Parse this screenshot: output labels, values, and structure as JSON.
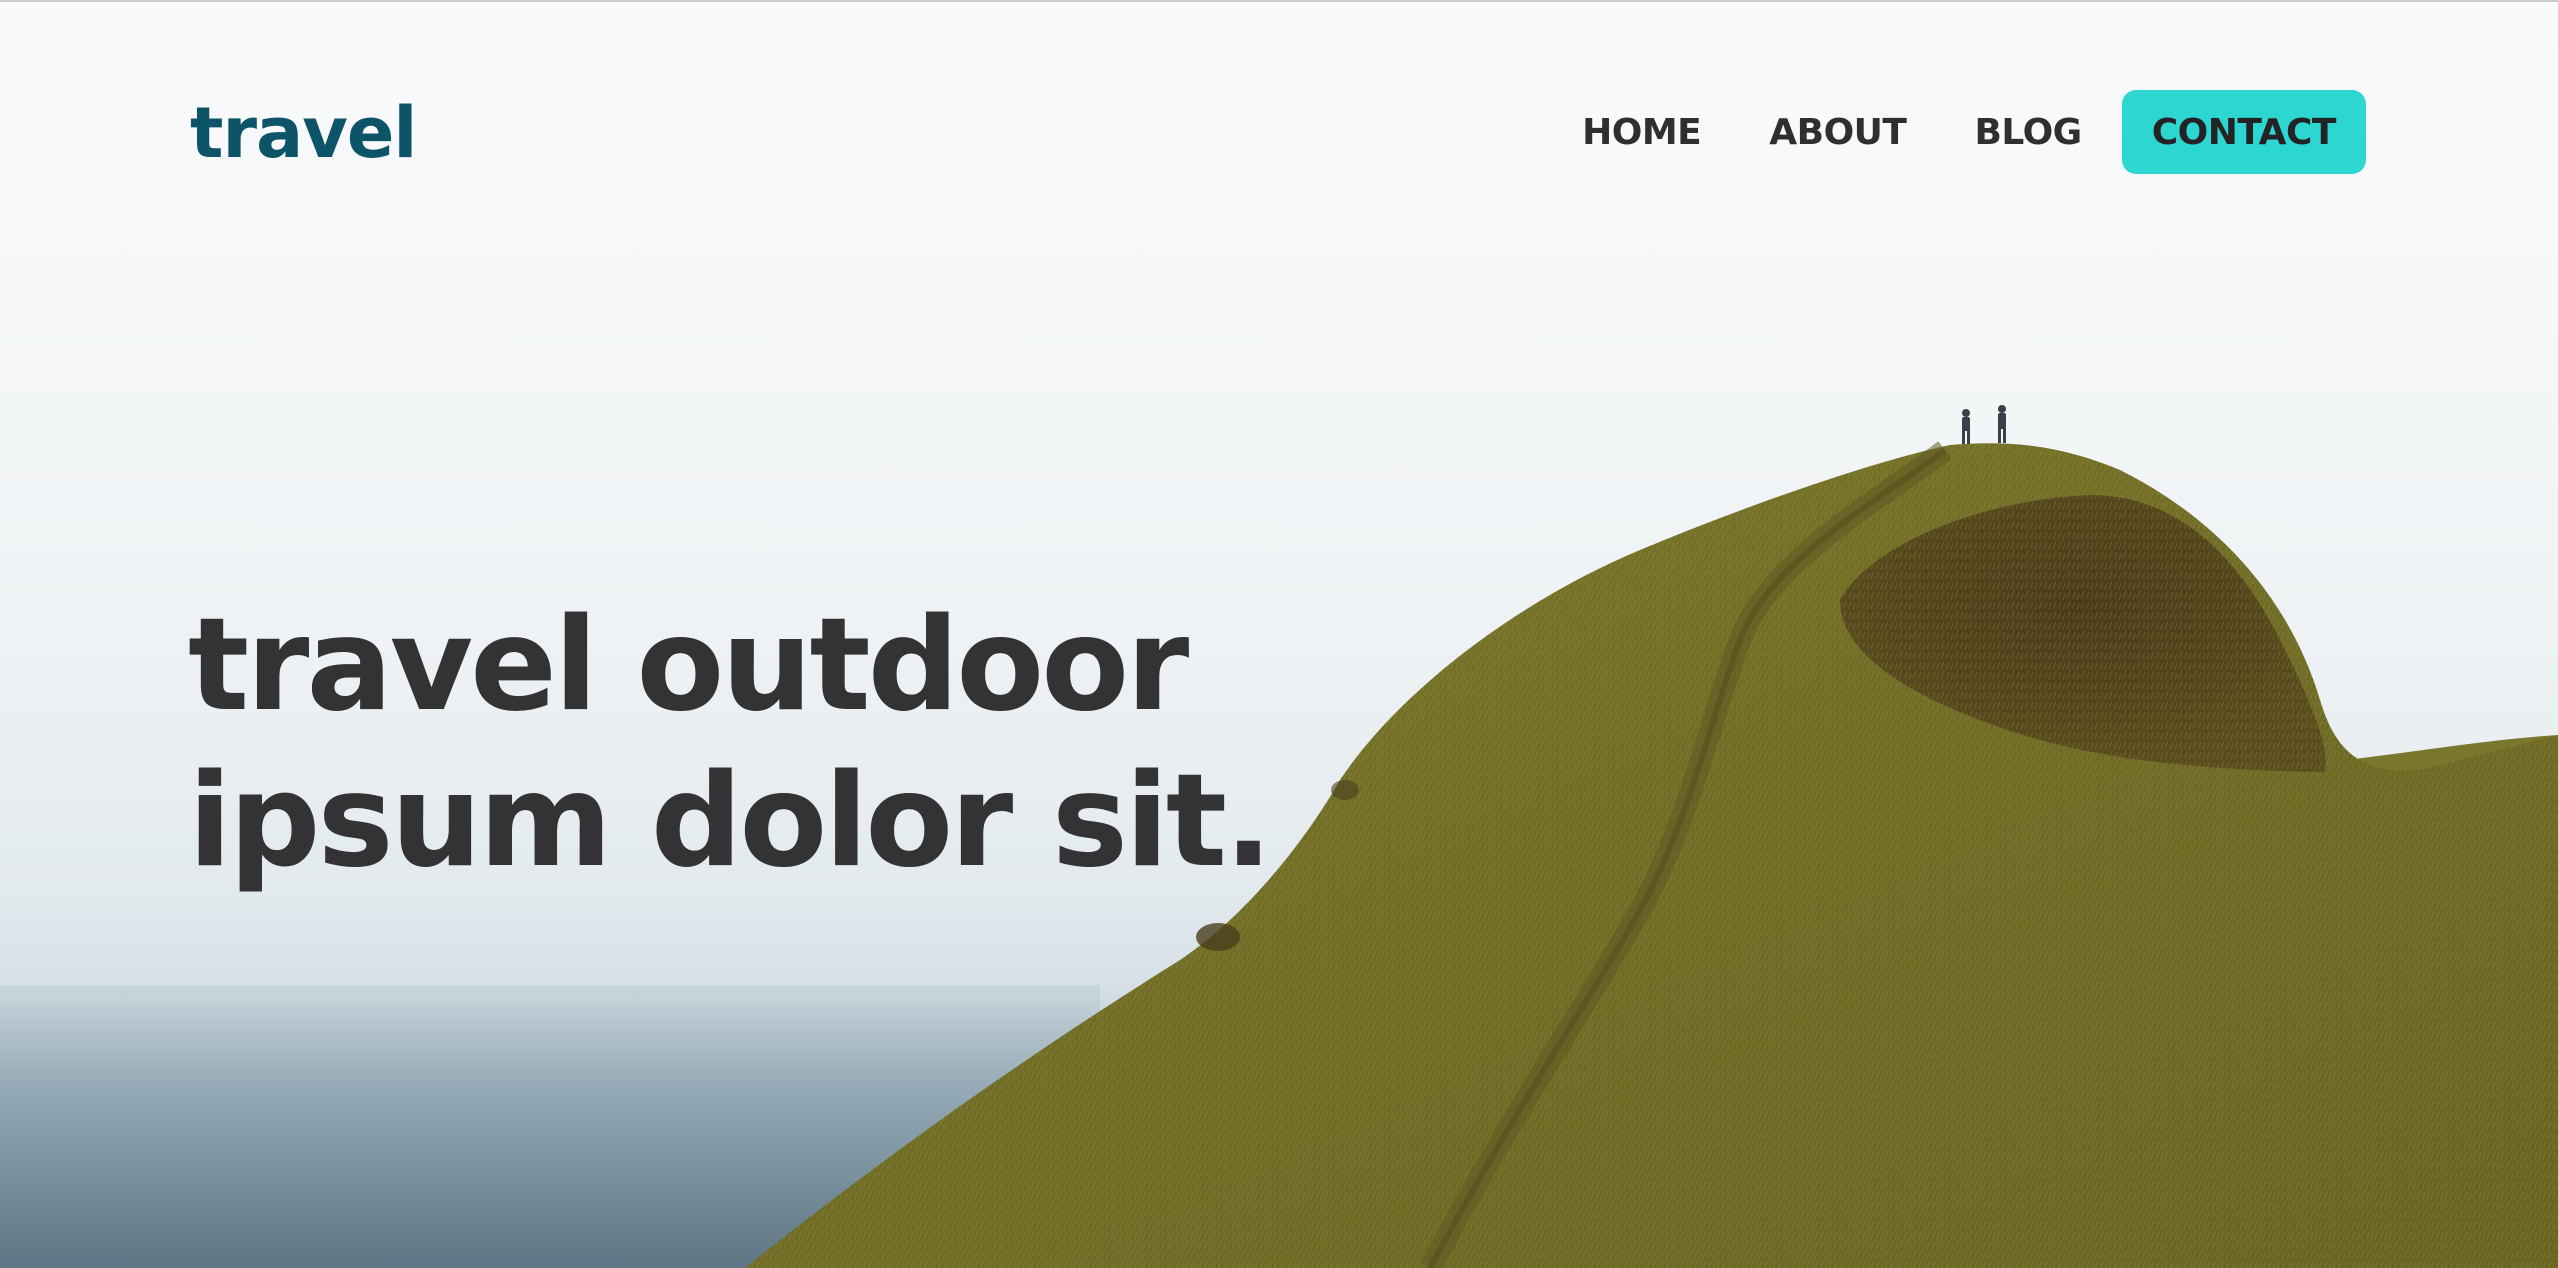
{
  "brand": {
    "logo_text": "travel",
    "logo_color": "#0d5469"
  },
  "nav": {
    "items": [
      {
        "label": "HOME"
      },
      {
        "label": "ABOUT"
      },
      {
        "label": "BLOG"
      }
    ],
    "contact_label": "CONTACT",
    "contact_color": "#2dd6d0"
  },
  "hero": {
    "line1": "travel outdoor",
    "line2": "ipsum dolor sit."
  }
}
